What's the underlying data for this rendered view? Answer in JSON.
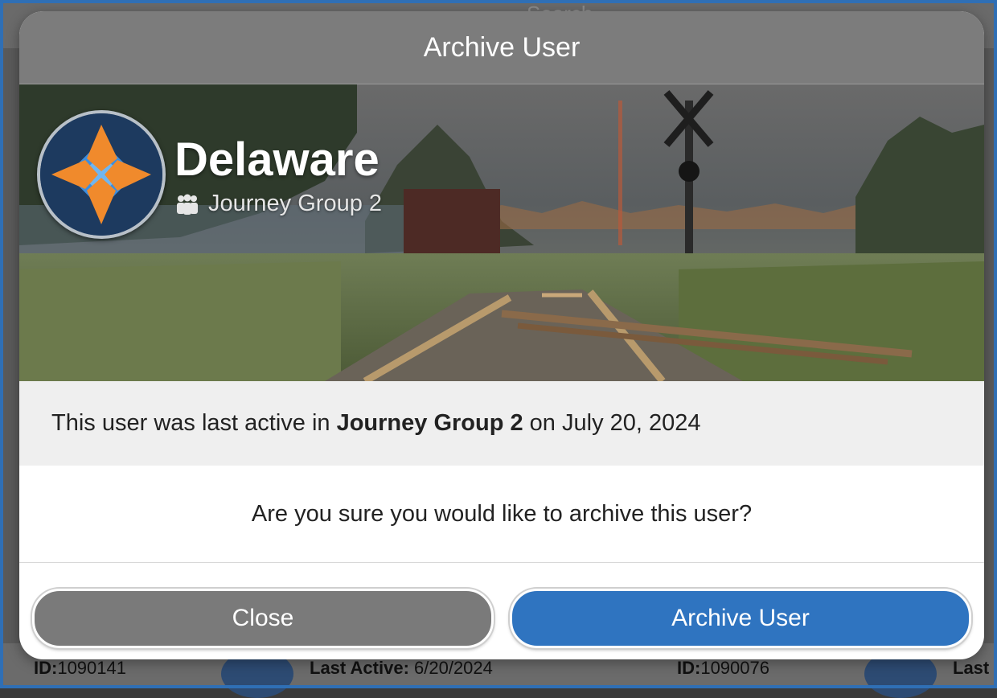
{
  "background": {
    "search_placeholder": "Search",
    "cards": [
      {
        "id_label": "ID:",
        "id_value": "1090141"
      },
      {
        "last_active_label": "Last Active:",
        "last_active_value": "6/20/2024"
      },
      {
        "id_label": "ID:",
        "id_value": "1090076"
      },
      {
        "last_active_label": "Last"
      }
    ]
  },
  "modal": {
    "title": "Archive User",
    "profile": {
      "name": "Delaware",
      "group_icon": "people-icon",
      "group": "Journey Group 2"
    },
    "info": {
      "prefix": "This user was last active in ",
      "group": "Journey Group 2",
      "suffix": " on July 20, 2024"
    },
    "question": "Are you sure you would like to archive this user?",
    "buttons": {
      "close": "Close",
      "archive": "Archive User"
    }
  },
  "colors": {
    "header": "#7c7c7c",
    "archive_button": "#2f74c0",
    "close_button": "#7a7a7a",
    "frame": "#2f6fb5"
  }
}
